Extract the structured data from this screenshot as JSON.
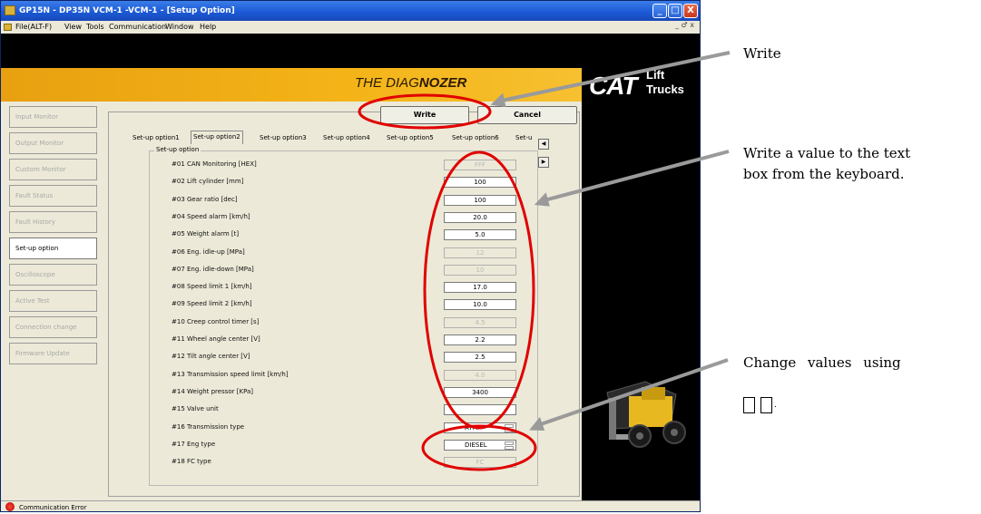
{
  "window": {
    "title": "GP15N - DP35N VCM-1 -VCM-1 - [Setup Option]",
    "controls": [
      "_",
      "□",
      "X"
    ]
  },
  "menu": {
    "items": [
      "File(ALT-F)",
      "View",
      "Tools",
      "Communication",
      "Window",
      "Help"
    ],
    "mdi_controls": "_ ♂ x"
  },
  "branding": {
    "diag_prefix": "THE DIAG",
    "diag_suffix": "NOZER",
    "cat": "CAT",
    "lift_line1": "Lift",
    "lift_line2": "Trucks"
  },
  "sidebar": {
    "items": [
      {
        "label": "Input Monitor",
        "active": false
      },
      {
        "label": "Output Monitor",
        "active": false
      },
      {
        "label": "Custom Monitor",
        "active": false
      },
      {
        "label": "Fault Status",
        "active": false
      },
      {
        "label": "Fault History",
        "active": false
      },
      {
        "label": "Set-up option",
        "active": true
      },
      {
        "label": "Oscilloscope",
        "active": false
      },
      {
        "label": "Active Test",
        "active": false
      },
      {
        "label": "Connection change",
        "active": false
      },
      {
        "label": "Firmware Update",
        "active": false
      }
    ]
  },
  "buttons": {
    "write": "Write",
    "cancel": "Cancel"
  },
  "tabs": {
    "items": [
      "Set-up option1",
      "Set-up option2",
      "Set-up option3",
      "Set-up option4",
      "Set-up option5",
      "Set-up option6",
      "Set-u"
    ],
    "selected": 1,
    "arrow_left": "◀",
    "arrow_right": "▶"
  },
  "setup": {
    "group_label": "Set-up option",
    "rows": [
      {
        "label": "#01 CAN Monitoring [HEX]",
        "value": "FFF",
        "enabled": false
      },
      {
        "label": "#02 Lift cylinder [mm]",
        "value": "100",
        "enabled": true
      },
      {
        "label": "#03 Gear ratio [dec]",
        "value": "100",
        "enabled": true
      },
      {
        "label": "#04 Speed alarm [km/h]",
        "value": "20.0",
        "enabled": true
      },
      {
        "label": "#05 Weight alarm [t]",
        "value": "5.0",
        "enabled": true
      },
      {
        "label": "#06 Eng. idle-up [MPa]",
        "value": "12",
        "enabled": false
      },
      {
        "label": "#07 Eng. idle-down [MPa]",
        "value": "10",
        "enabled": false
      },
      {
        "label": "#08 Speed limit 1 [km/h]",
        "value": "17.0",
        "enabled": true
      },
      {
        "label": "#09 Speed limit 2 [km/h]",
        "value": "10.0",
        "enabled": true
      },
      {
        "label": "#10 Creep control timer [s]",
        "value": "4.5",
        "enabled": false
      },
      {
        "label": "#11 Wheel angle center [V]",
        "value": "2.2",
        "enabled": true
      },
      {
        "label": "#12 Tilt angle center [V]",
        "value": "2.5",
        "enabled": true
      },
      {
        "label": "#13 Transmission speed limit [km/h]",
        "value": "4.0",
        "enabled": false
      },
      {
        "label": "#14 Weight pressor [KPa]",
        "value": "3400",
        "enabled": true
      },
      {
        "label": "#15 Valve unit",
        "value": "",
        "enabled": true
      },
      {
        "label": "#16 Transmission type",
        "value": "ATM",
        "enabled": true,
        "combo": true
      },
      {
        "label": "#17 Eng type",
        "value": "DIESEL",
        "enabled": true,
        "combo": true
      },
      {
        "label": "#18 FC type",
        "value": "FC",
        "enabled": false
      }
    ]
  },
  "status": {
    "text": "Communication Error"
  },
  "annotations": {
    "write": "Write",
    "text_box_line1": "Write a value to the text",
    "text_box_line2": "box from the keyboard.",
    "change_line1": "Change values using",
    "change_line2": "."
  },
  "colors": {
    "banner": "#f4b418",
    "title_bar": "#1c5ad6",
    "highlight_ellipse": "#e00000",
    "arrow": "#9a9a9a",
    "status_error": "#d00000"
  }
}
